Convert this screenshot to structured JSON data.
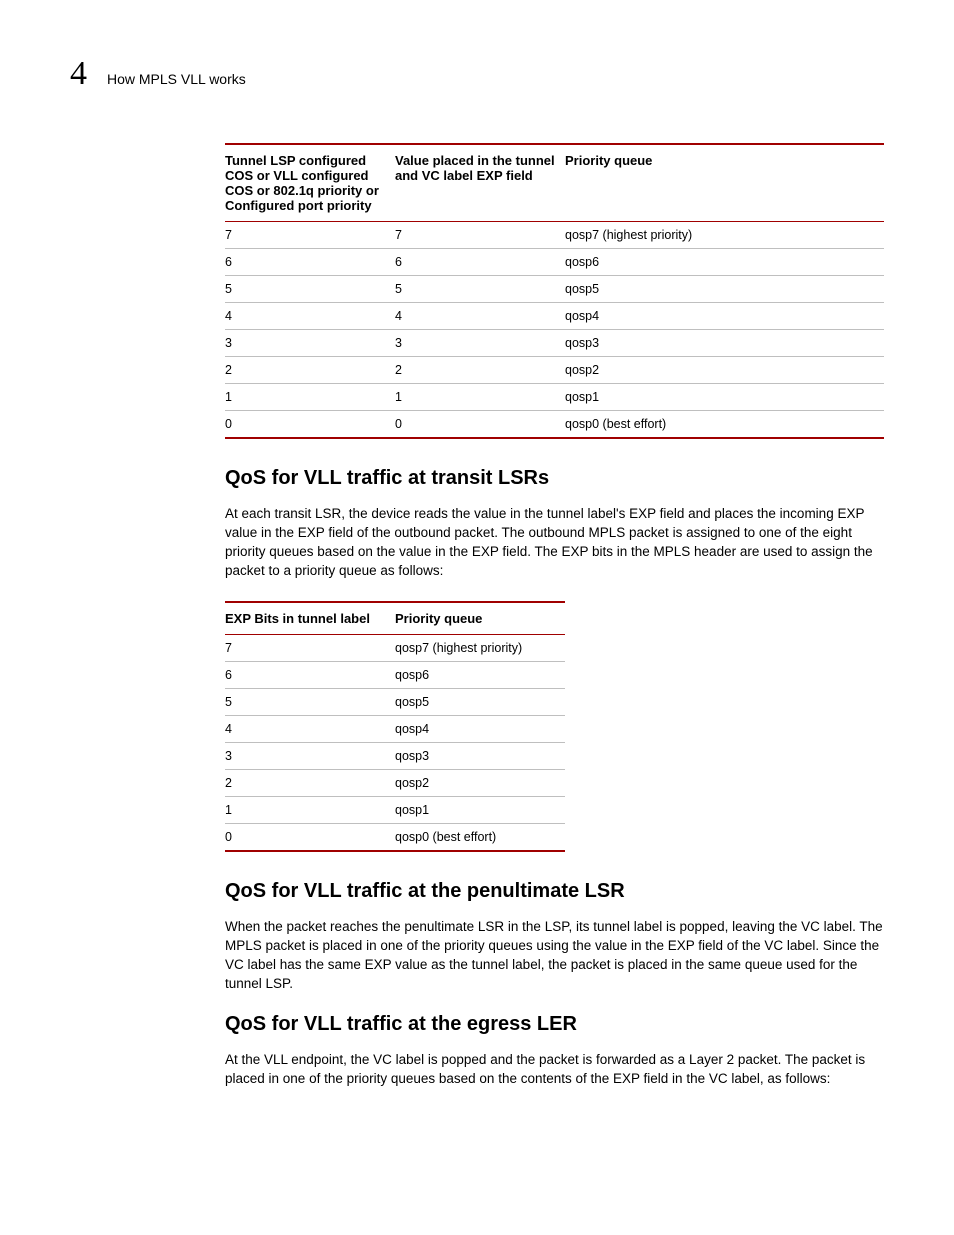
{
  "header": {
    "chapter_number": "4",
    "chapter_title": "How MPLS VLL works"
  },
  "table1": {
    "headers": {
      "h1": "Tunnel LSP configured COS or VLL configured COS or 802.1q priority or Configured port priority",
      "h2": "Value placed in the tunnel and VC label EXP field",
      "h3": "Priority queue"
    },
    "rows": [
      {
        "a": "7",
        "b": "7",
        "c": "qosp7 (highest priority)"
      },
      {
        "a": "6",
        "b": "6",
        "c": "qosp6"
      },
      {
        "a": "5",
        "b": "5",
        "c": "qosp5"
      },
      {
        "a": "4",
        "b": "4",
        "c": "qosp4"
      },
      {
        "a": "3",
        "b": "3",
        "c": "qosp3"
      },
      {
        "a": "2",
        "b": "2",
        "c": "qosp2"
      },
      {
        "a": "1",
        "b": "1",
        "c": "qosp1"
      },
      {
        "a": "0",
        "b": "0",
        "c": "qosp0 (best effort)"
      }
    ]
  },
  "section1": {
    "heading": "QoS for VLL traffic at transit LSRs",
    "body": "At each transit LSR, the device reads the value in the tunnel label's EXP field and places the incoming EXP value in the EXP field of the outbound packet. The outbound MPLS packet is assigned to one of the eight priority queues based on the value in the EXP field. The EXP bits in the MPLS header are used to assign the packet to a priority queue as follows:"
  },
  "table2": {
    "headers": {
      "h1": "EXP Bits in tunnel label",
      "h2": "Priority queue"
    },
    "rows": [
      {
        "a": "7",
        "b": "qosp7 (highest priority)"
      },
      {
        "a": "6",
        "b": "qosp6"
      },
      {
        "a": "5",
        "b": "qosp5"
      },
      {
        "a": "4",
        "b": "qosp4"
      },
      {
        "a": "3",
        "b": "qosp3"
      },
      {
        "a": "2",
        "b": "qosp2"
      },
      {
        "a": "1",
        "b": "qosp1"
      },
      {
        "a": "0",
        "b": "qosp0 (best effort)"
      }
    ]
  },
  "section2": {
    "heading": "QoS for VLL traffic at the penultimate LSR",
    "body": "When the packet reaches the penultimate LSR in the LSP, its tunnel label is popped, leaving the VC label. The MPLS packet is placed in one of the priority queues using the value in the EXP field of the VC label. Since the VC label has the same EXP value as the tunnel label, the packet is placed in the same queue used for the tunnel LSP."
  },
  "section3": {
    "heading": "QoS for VLL traffic at the egress LER",
    "body": "At the VLL endpoint, the VC label is popped and the packet is forwarded as a Layer 2 packet. The packet is placed in one of the priority queues based on the contents of the EXP field in the VC label, as follows:"
  }
}
